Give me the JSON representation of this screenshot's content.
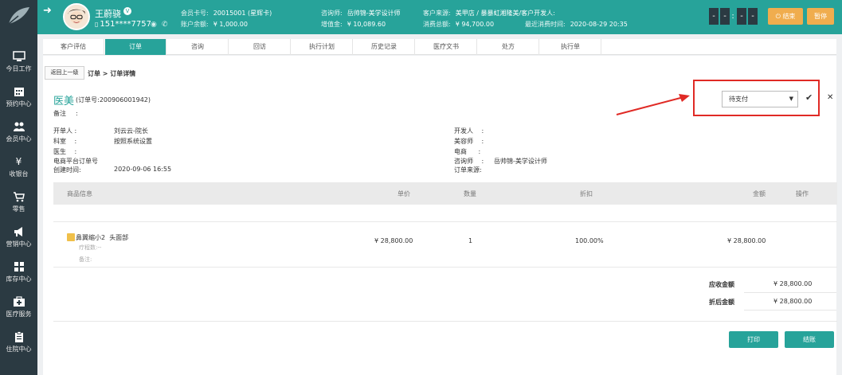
{
  "sidebar": {
    "items": [
      {
        "label": "今日工作",
        "icon": "monitor-icon"
      },
      {
        "label": "预约中心",
        "icon": "calendar-icon"
      },
      {
        "label": "会员中心",
        "icon": "users-icon"
      },
      {
        "label": "收银台",
        "icon": "yen-icon"
      },
      {
        "label": "零售",
        "icon": "cart-icon"
      },
      {
        "label": "营销中心",
        "icon": "megaphone-icon"
      },
      {
        "label": "库存中心",
        "icon": "grid-icon"
      },
      {
        "label": "医疗服务",
        "icon": "medkit-icon"
      },
      {
        "label": "住院中心",
        "icon": "clipboard-icon"
      }
    ]
  },
  "header": {
    "name": "王蔚骁",
    "phone": "151****7757",
    "card_label": "会员卡号:",
    "card_value": "20015001 (星辉卡)",
    "balance_label": "账户余额:",
    "balance_value": "¥ 1,000.00",
    "consultant_label": "咨询师:",
    "consultant_value": "岳帅锦-美学设计师",
    "deposit_label": "增值金:",
    "deposit_value": "¥ 10,089.60",
    "source_label": "客户来源:",
    "source_value": "美甲店 / 暴暴虹湘隆美/客户开发人:",
    "total_label": "消费总额:",
    "total_value": "¥ 94,700.00",
    "last_label": "最近消费时间:",
    "last_value": "2020-08-29 20:35",
    "timer": [
      "-",
      "-",
      "-",
      "-"
    ],
    "end_btn": "结束",
    "pause_btn": "暂停",
    "accent": "#27a39a"
  },
  "tabs": [
    {
      "label": "客户评估",
      "active": false
    },
    {
      "label": "订单",
      "active": true
    },
    {
      "label": "咨询",
      "active": false
    },
    {
      "label": "回访",
      "active": false
    },
    {
      "label": "执行计划",
      "active": false
    },
    {
      "label": "历史记录",
      "active": false
    },
    {
      "label": "医疗文书",
      "active": false
    },
    {
      "label": "处方",
      "active": false
    },
    {
      "label": "执行单",
      "active": false
    }
  ],
  "main": {
    "back_btn": "返回上一级",
    "breadcrumb": "订单 > 订单详情",
    "title": "医美",
    "order_no": "(订单号:200906001942)",
    "remark_label": "备注",
    "remark_sep": ":",
    "status_select": "待支付",
    "info_left": [
      {
        "k": "开单人",
        "sep": ":",
        "v": "刘云云-院长"
      },
      {
        "k": "科室",
        "sep": ":",
        "v": "按照系统设置"
      },
      {
        "k": "医生",
        "sep": ":",
        "v": ""
      },
      {
        "k": "电商平台订单号",
        "sep": "",
        "v": ""
      },
      {
        "k": "创建时间:",
        "sep": "",
        "v": "2020-09-06 16:55"
      }
    ],
    "info_right": [
      {
        "k": "开发人",
        "sep": ":",
        "v": ""
      },
      {
        "k": "美容师",
        "sep": ":",
        "v": ""
      },
      {
        "k": "电商",
        "sep": ":",
        "v": ""
      },
      {
        "k": "咨询师",
        "sep": ":",
        "v": "岳帅锦-美学设计师"
      },
      {
        "k": "订单来源:",
        "sep": "",
        "v": ""
      }
    ],
    "table_headers": {
      "product": "商品信息",
      "price": "单价",
      "qty": "数量",
      "discount": "折扣",
      "amount": "金额",
      "op": "操作"
    },
    "row": {
      "product": "鼻翼缩小2",
      "part": "头面部",
      "sub1": "疗程数:--",
      "sub2": "备注:",
      "price": "¥ 28,800.00",
      "qty": "1",
      "discount": "100.00%",
      "amount": "¥ 28,800.00"
    },
    "receivable_label": "应收金额",
    "receivable_value": "¥ 28,800.00",
    "after_discount_label": "折后金额",
    "after_discount_value": "¥ 28,800.00",
    "print_btn": "打印",
    "checkout_btn": "结账"
  }
}
